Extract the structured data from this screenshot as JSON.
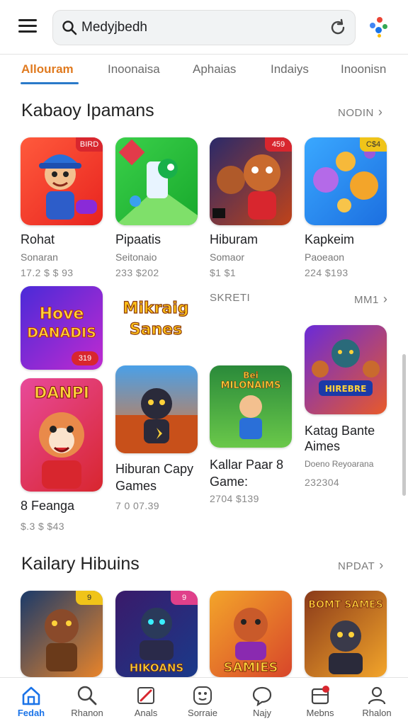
{
  "search": {
    "text": "Medyjbedh"
  },
  "tabs": [
    {
      "label": "Allouram",
      "active": true
    },
    {
      "label": "Inoonaisa",
      "active": false
    },
    {
      "label": "Aphaias",
      "active": false
    },
    {
      "label": "Indaiys",
      "active": false
    },
    {
      "label": "Inoonisn",
      "active": false
    }
  ],
  "section1": {
    "title": "Kabaoy Ipamans",
    "more": "NODIN",
    "row1": [
      {
        "name": "Rohat",
        "sub": "Sonaran",
        "price": "17.2 $ $ 93",
        "badge": "BIRD"
      },
      {
        "name": "Pipaatis",
        "sub": "Seitonaio",
        "price": "233 $202",
        "badge": ""
      },
      {
        "name": "Hiburam",
        "sub": "Somaor",
        "price": "$1 $1",
        "badge": "459"
      },
      {
        "name": "Kapkeim",
        "sub": "Paoeaon",
        "price": "224 $193",
        "badge": "C$4"
      }
    ],
    "row2_left": {
      "name": "8 Feanga",
      "price": "$.3 $ $43"
    },
    "row2_left_top_badge": "319",
    "title_art_text": "Mikraig Sanes",
    "mini_header": {
      "title": "SKRETI",
      "more": "MM1"
    },
    "row2": [
      {
        "name": "Hiburan Capy Games",
        "price": "7 0 07.39"
      },
      {
        "name": "Kallar Paar 8 Game:",
        "price": "2704 $139"
      },
      {
        "name": "Katag Bante Aimes",
        "sub": "Doeno Reyoarana",
        "price": "232304"
      }
    ],
    "art_text": {
      "hove": "Hove DANADIS",
      "danpi": "DANPI",
      "milonaims": "Bei MILONAIMS",
      "hirebre": "HIREBRE"
    }
  },
  "section2": {
    "title": "Kailary Hibuins",
    "more": "NPDAT",
    "apps": [
      {
        "badge": "9",
        "art": ""
      },
      {
        "badge": "9",
        "art": "HIKOANS"
      },
      {
        "badge": "",
        "art": "SAMIES"
      },
      {
        "badge": "",
        "art": "BOMT SAMES"
      }
    ]
  },
  "nav": [
    {
      "label": "Fedah",
      "icon": "home-icon",
      "active": true
    },
    {
      "label": "Rhanon",
      "icon": "search-icon",
      "active": false
    },
    {
      "label": "Anals",
      "icon": "pencil-icon",
      "active": false
    },
    {
      "label": "Sorraie",
      "icon": "smile-icon",
      "active": false
    },
    {
      "label": "Najy",
      "icon": "chat-icon",
      "active": false
    },
    {
      "label": "Mebns",
      "icon": "inbox-icon",
      "active": false
    },
    {
      "label": "Rhalon",
      "icon": "profile-icon",
      "active": false
    }
  ],
  "colors": {
    "accent": "#e07a1f",
    "nav_active": "#1a73e8",
    "badge": "#d8262e"
  }
}
